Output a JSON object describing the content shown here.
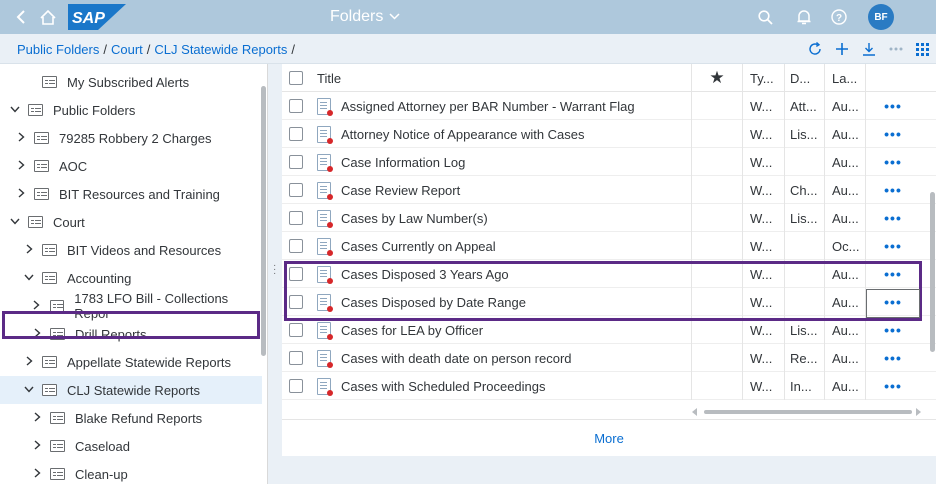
{
  "shell": {
    "title": "Folders",
    "avatar_initials": "BF",
    "icons": [
      "back-icon",
      "home-icon",
      "search-icon",
      "bell-icon",
      "help-icon"
    ]
  },
  "breadcrumb": {
    "items": [
      "Public Folders",
      "Court",
      "CLJ Statewide Reports"
    ],
    "separator": "/"
  },
  "toolbar": {
    "icons": [
      "refresh-icon",
      "add-icon",
      "download-icon",
      "more-icon",
      "grid-icon"
    ]
  },
  "tree": {
    "items": [
      {
        "label": "My Subscribed Alerts",
        "expander": "none",
        "selected": false
      },
      {
        "label": "Public Folders",
        "expander": "expanded",
        "selected": false
      },
      {
        "label": "79285 Robbery 2 Charges",
        "expander": "collapsed",
        "selected": false
      },
      {
        "label": "AOC",
        "expander": "collapsed",
        "selected": false
      },
      {
        "label": "BIT Resources and Training",
        "expander": "collapsed",
        "selected": false
      },
      {
        "label": "Court",
        "expander": "expanded",
        "selected": false
      },
      {
        "label": "BIT Videos and Resources",
        "expander": "collapsed",
        "selected": false
      },
      {
        "label": "Accounting",
        "expander": "expanded",
        "selected": false
      },
      {
        "label": "1783 LFO Bill - Collections Repor",
        "expander": "collapsed",
        "selected": false
      },
      {
        "label": "Drill Reports",
        "expander": "collapsed",
        "selected": false
      },
      {
        "label": "Appellate Statewide Reports",
        "expander": "collapsed",
        "selected": false
      },
      {
        "label": "CLJ Statewide Reports",
        "expander": "expanded",
        "selected": true
      },
      {
        "label": "Blake Refund Reports",
        "expander": "collapsed",
        "selected": false
      },
      {
        "label": "Caseload",
        "expander": "collapsed",
        "selected": false
      },
      {
        "label": "Clean-up",
        "expander": "collapsed",
        "selected": false
      }
    ]
  },
  "table": {
    "columns": [
      "Title",
      "★",
      "Ty...",
      "D...",
      "La..."
    ],
    "rows": [
      {
        "title": "Assigned Attorney per BAR Number - Warrant Flag",
        "type": "W...",
        "desc": "Att...",
        "last": "Au...",
        "more": "•••"
      },
      {
        "title": "Attorney Notice of Appearance with Cases",
        "type": "W...",
        "desc": "Lis...",
        "last": "Au...",
        "more": "•••"
      },
      {
        "title": "Case Information Log",
        "type": "W...",
        "desc": "",
        "last": "Au...",
        "more": "•••"
      },
      {
        "title": "Case Review Report",
        "type": "W...",
        "desc": "Ch...",
        "last": "Au...",
        "more": "•••"
      },
      {
        "title": "Cases by Law Number(s)",
        "type": "W...",
        "desc": "Lis...",
        "last": "Au...",
        "more": "•••"
      },
      {
        "title": "Cases Currently on Appeal",
        "type": "W...",
        "desc": "",
        "last": "Oc...",
        "more": "•••"
      },
      {
        "title": "Cases Disposed 3 Years Ago",
        "type": "W...",
        "desc": "",
        "last": "Au...",
        "more": "•••"
      },
      {
        "title": "Cases Disposed by Date Range",
        "type": "W...",
        "desc": "",
        "last": "Au...",
        "more": "•••"
      },
      {
        "title": "Cases for LEA by Officer",
        "type": "W...",
        "desc": "Lis...",
        "last": "Au...",
        "more": "•••"
      },
      {
        "title": "Cases with death date on person record",
        "type": "W...",
        "desc": "Re...",
        "last": "Au...",
        "more": "•••"
      },
      {
        "title": "Cases with Scheduled Proceedings",
        "type": "W...",
        "desc": "In...",
        "last": "Au...",
        "more": "•••"
      }
    ],
    "more_label": "More"
  },
  "colors": {
    "shell_bg": "#aec8dc",
    "link": "#0a6ed1",
    "highlight_border": "#5b2a86",
    "avatar_bg": "#2a7bc3"
  }
}
